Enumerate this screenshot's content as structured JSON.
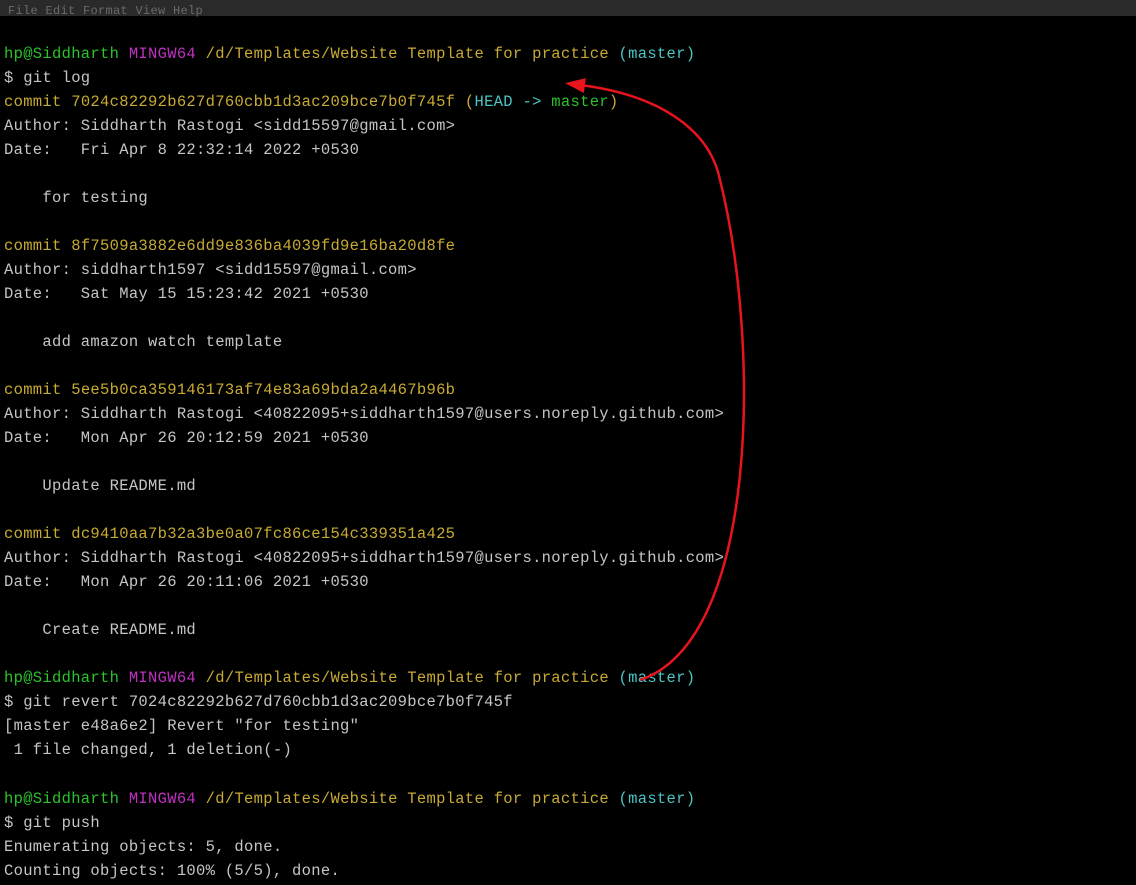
{
  "menubar": "File  Edit  Format  View  Help",
  "prompt1": {
    "user": "hp@Siddharth",
    "env": "MINGW64",
    "path": "/d/Templates/Website Template for practice",
    "branch": "(master)"
  },
  "cmd1": "$ git log",
  "commit1": {
    "label": "commit ",
    "hash": "7024c82292b627d760cbb1d3ac209bce7b0f745f",
    "refopen": " (",
    "head": "HEAD -> ",
    "branch": "master",
    "refclose": ")",
    "author": "Author: Siddharth Rastogi <sidd15597@gmail.com>",
    "date": "Date:   Fri Apr 8 22:32:14 2022 +0530",
    "msg": "    for testing"
  },
  "commit2": {
    "label": "commit ",
    "hash": "8f7509a3882e6dd9e836ba4039fd9e16ba20d8fe",
    "author": "Author: siddharth1597 <sidd15597@gmail.com>",
    "date": "Date:   Sat May 15 15:23:42 2021 +0530",
    "msg": "    add amazon watch template"
  },
  "commit3": {
    "label": "commit ",
    "hash": "5ee5b0ca359146173af74e83a69bda2a4467b96b",
    "author": "Author: Siddharth Rastogi <40822095+siddharth1597@users.noreply.github.com>",
    "date": "Date:   Mon Apr 26 20:12:59 2021 +0530",
    "msg": "    Update README.md"
  },
  "commit4": {
    "label": "commit ",
    "hash": "dc9410aa7b32a3be0a07fc86ce154c339351a425",
    "author": "Author: Siddharth Rastogi <40822095+siddharth1597@users.noreply.github.com>",
    "date": "Date:   Mon Apr 26 20:11:06 2021 +0530",
    "msg": "    Create README.md"
  },
  "cmd2": "$ git revert 7024c82292b627d760cbb1d3ac209bce7b0f745f",
  "revert_out1": "[master e48a6e2] Revert \"for testing\"",
  "revert_out2": " 1 file changed, 1 deletion(-)",
  "cmd3": "$ git push",
  "push_out1": "Enumerating objects: 5, done.",
  "push_out2": "Counting objects: 100% (5/5), done."
}
